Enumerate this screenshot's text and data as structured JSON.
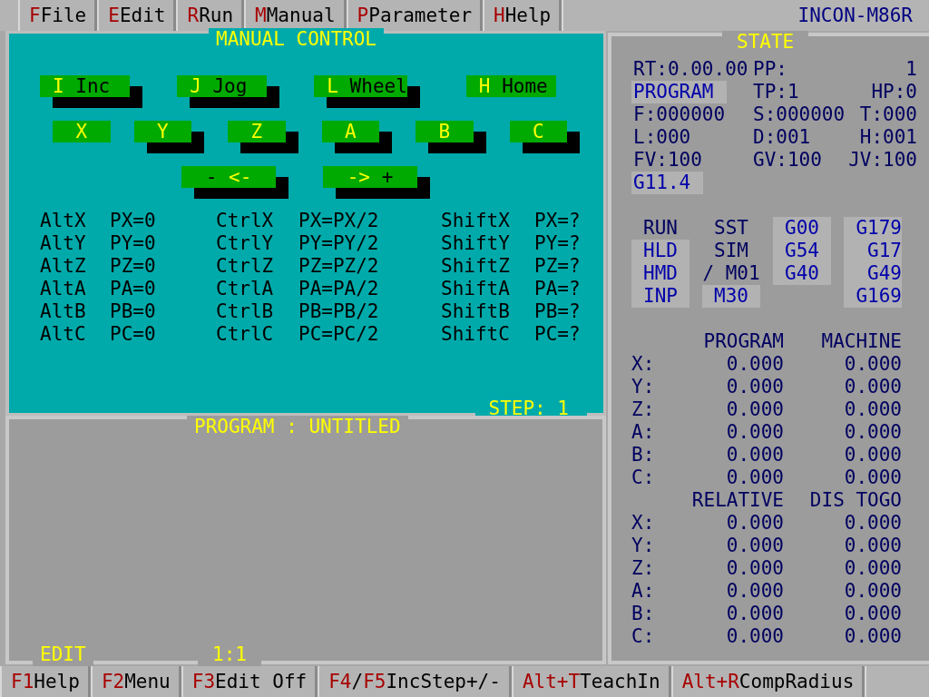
{
  "menu": [
    {
      "parts": [
        {
          "text": "F",
          "hot": true
        },
        {
          "text": "File",
          "hot": false
        }
      ]
    },
    {
      "parts": [
        {
          "text": "E",
          "hot": true
        },
        {
          "text": "Edit",
          "hot": false
        }
      ]
    },
    {
      "parts": [
        {
          "text": "R",
          "hot": true
        },
        {
          "text": "Run",
          "hot": false
        }
      ]
    },
    {
      "parts": [
        {
          "text": "M",
          "hot": true
        },
        {
          "text": "Manual",
          "hot": false
        }
      ]
    },
    {
      "parts": [
        {
          "text": "P",
          "hot": true
        },
        {
          "text": "Parameter",
          "hot": false
        }
      ]
    },
    {
      "parts": [
        {
          "text": "H",
          "hot": true
        },
        {
          "text": "Help",
          "hot": false
        }
      ]
    }
  ],
  "model": "INCON-M86R",
  "manual": {
    "title": "MANUAL CONTROL",
    "step_label": "STEP:    1",
    "button_rows": [
      [
        {
          "parts": [
            {
              "text": "I",
              "hot": true
            },
            {
              "text": " Inc",
              "hot": false
            }
          ],
          "selected": false
        },
        {
          "parts": [
            {
              "text": "J",
              "hot": true
            },
            {
              "text": " Jog",
              "hot": false
            }
          ],
          "selected": false
        },
        {
          "parts": [
            {
              "text": "L",
              "hot": true
            },
            {
              "text": " Wheel",
              "hot": false
            }
          ],
          "selected": false
        },
        {
          "parts": [
            {
              "text": "H",
              "hot": true
            },
            {
              "text": " Home",
              "hot": false
            }
          ],
          "selected": true
        }
      ],
      [
        {
          "parts": [
            {
              "text": "X",
              "hot": true
            }
          ],
          "selected": true
        },
        {
          "parts": [
            {
              "text": "Y",
              "hot": true
            }
          ],
          "selected": false
        },
        {
          "parts": [
            {
              "text": "Z",
              "hot": true
            }
          ],
          "selected": false
        },
        {
          "parts": [
            {
              "text": "A",
              "hot": true
            }
          ],
          "selected": false
        },
        {
          "parts": [
            {
              "text": "B",
              "hot": true
            }
          ],
          "selected": false
        },
        {
          "parts": [
            {
              "text": "C",
              "hot": true
            }
          ],
          "selected": false
        }
      ],
      [
        {
          "parts": [
            {
              "text": "-",
              "hot": false
            },
            {
              "text": " <-",
              "hot": true
            }
          ],
          "selected": false
        },
        {
          "parts": [
            {
              "text": "->",
              "hot": true
            },
            {
              "text": " +",
              "hot": false
            }
          ],
          "selected": false
        }
      ]
    ],
    "shortcut_columns": [
      [
        {
          "key": "AltX",
          "action": "PX=0"
        },
        {
          "key": "AltY",
          "action": "PY=0"
        },
        {
          "key": "AltZ",
          "action": "PZ=0"
        },
        {
          "key": "AltA",
          "action": "PA=0"
        },
        {
          "key": "AltB",
          "action": "PB=0"
        },
        {
          "key": "AltC",
          "action": "PC=0"
        }
      ],
      [
        {
          "key": "CtrlX",
          "action": "PX=PX/2"
        },
        {
          "key": "CtrlY",
          "action": "PY=PY/2"
        },
        {
          "key": "CtrlZ",
          "action": "PZ=PZ/2"
        },
        {
          "key": "CtrlA",
          "action": "PA=PA/2"
        },
        {
          "key": "CtrlB",
          "action": "PB=PB/2"
        },
        {
          "key": "CtrlC",
          "action": "PC=PC/2"
        }
      ],
      [
        {
          "key": "ShiftX",
          "action": "PX=?"
        },
        {
          "key": "ShiftY",
          "action": "PY=?"
        },
        {
          "key": "ShiftZ",
          "action": "PZ=?"
        },
        {
          "key": "ShiftA",
          "action": "PA=?"
        },
        {
          "key": "ShiftB",
          "action": "PB=?"
        },
        {
          "key": "ShiftC",
          "action": "PC=?"
        }
      ]
    ]
  },
  "program": {
    "title": "PROGRAM : UNTITLED",
    "mode": "EDIT",
    "position": "1:1"
  },
  "state": {
    "title": "STATE",
    "info_rows": [
      [
        {
          "text": "RT:0.00.00",
          "active": false
        },
        {
          "text": "PP:",
          "active": false
        },
        {
          "text": "1",
          "active": false
        }
      ],
      [
        {
          "text": "PROGRAM",
          "active": true
        },
        {
          "text": "TP:1",
          "active": false
        },
        {
          "text": "HP:0",
          "active": false
        }
      ],
      [
        {
          "text": "F:000000",
          "active": false
        },
        {
          "text": "S:000000",
          "active": false
        },
        {
          "text": "T:000",
          "active": false
        }
      ],
      [
        {
          "text": "L:000",
          "active": false
        },
        {
          "text": "D:001",
          "active": false
        },
        {
          "text": "H:001",
          "active": false
        }
      ],
      [
        {
          "text": "FV:100",
          "active": false
        },
        {
          "text": "GV:100",
          "active": false
        },
        {
          "text": "JV:100",
          "active": false
        }
      ],
      [
        {
          "text": "G11.4",
          "active": true
        }
      ]
    ],
    "mode_columns": [
      [
        {
          "text": "RUN",
          "active": false
        },
        {
          "text": "HLD",
          "active": true
        },
        {
          "text": "HMD",
          "active": true
        },
        {
          "text": "INP",
          "active": true
        }
      ],
      [
        {
          "text": "SST",
          "active": false
        },
        {
          "text": "SIM",
          "active": false
        },
        {
          "text": "/ M01",
          "active": false
        },
        {
          "text": "M30",
          "active": true
        }
      ],
      [
        {
          "text": "G00",
          "active": true
        },
        {
          "text": "G54",
          "active": true
        },
        {
          "text": "G40",
          "active": true
        }
      ],
      [
        {
          "text": "G179",
          "active": true
        },
        {
          "text": "G17",
          "active": true
        },
        {
          "text": "G49",
          "active": true
        },
        {
          "text": "G169",
          "active": true
        }
      ]
    ],
    "coordinate_sections": [
      {
        "headers": [
          "PROGRAM",
          "MACHINE"
        ],
        "rows": [
          {
            "axis": "X:",
            "values": [
              "0.000",
              "0.000"
            ]
          },
          {
            "axis": "Y:",
            "values": [
              "0.000",
              "0.000"
            ]
          },
          {
            "axis": "Z:",
            "values": [
              "0.000",
              "0.000"
            ]
          },
          {
            "axis": "A:",
            "values": [
              "0.000",
              "0.000"
            ]
          },
          {
            "axis": "B:",
            "values": [
              "0.000",
              "0.000"
            ]
          },
          {
            "axis": "C:",
            "values": [
              "0.000",
              "0.000"
            ]
          }
        ]
      },
      {
        "headers": [
          "RELATIVE",
          "DIS TOGO"
        ],
        "rows": [
          {
            "axis": "X:",
            "values": [
              "0.000",
              "0.000"
            ]
          },
          {
            "axis": "Y:",
            "values": [
              "0.000",
              "0.000"
            ]
          },
          {
            "axis": "Z:",
            "values": [
              "0.000",
              "0.000"
            ]
          },
          {
            "axis": "A:",
            "values": [
              "0.000",
              "0.000"
            ]
          },
          {
            "axis": "B:",
            "values": [
              "0.000",
              "0.000"
            ]
          },
          {
            "axis": "C:",
            "values": [
              "0.000",
              "0.000"
            ]
          }
        ]
      }
    ]
  },
  "function_keys": [
    {
      "parts": [
        {
          "text": "F1",
          "hot": true
        },
        {
          "text": "Help",
          "hot": false
        }
      ]
    },
    {
      "parts": [
        {
          "text": "F2",
          "hot": true
        },
        {
          "text": "Menu",
          "hot": false
        }
      ]
    },
    {
      "parts": [
        {
          "text": "F3",
          "hot": true
        },
        {
          "text": "Edit Off",
          "hot": false
        }
      ]
    },
    {
      "parts": [
        {
          "text": "F4",
          "hot": true
        },
        {
          "text": "/",
          "hot": false
        },
        {
          "text": "F5",
          "hot": true
        },
        {
          "text": "IncStep+/-",
          "hot": false
        }
      ]
    },
    {
      "parts": [
        {
          "text": "Alt+T",
          "hot": true
        },
        {
          "text": "TeachIn",
          "hot": false
        }
      ]
    },
    {
      "parts": [
        {
          "text": "Alt+R",
          "hot": true
        },
        {
          "text": "CompRadius",
          "hot": false
        }
      ]
    }
  ]
}
